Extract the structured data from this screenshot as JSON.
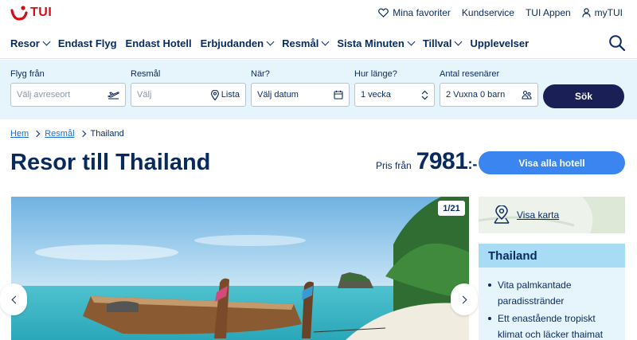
{
  "header": {
    "logo_text": "TUI",
    "links": [
      {
        "label": "Mina favoriter",
        "icon": "heart-icon"
      },
      {
        "label": "Kundservice"
      },
      {
        "label": "TUI Appen"
      },
      {
        "label": "myTUI",
        "icon": "user-icon"
      }
    ]
  },
  "nav": {
    "items": [
      {
        "label": "Resor",
        "dropdown": true
      },
      {
        "label": "Endast Flyg",
        "dropdown": false
      },
      {
        "label": "Endast Hotell",
        "dropdown": false
      },
      {
        "label": "Erbjudanden",
        "dropdown": true
      },
      {
        "label": "Resmål",
        "dropdown": true
      },
      {
        "label": "Sista Minuten",
        "dropdown": true
      },
      {
        "label": "Tillval",
        "dropdown": true
      },
      {
        "label": "Upplevelser",
        "dropdown": false
      }
    ]
  },
  "search": {
    "from": {
      "label": "Flyg från",
      "placeholder": "Välj avreseort"
    },
    "dest": {
      "label": "Resmål",
      "placeholder": "Välj",
      "list_label": "Lista"
    },
    "when": {
      "label": "När?",
      "value": "Välj datum"
    },
    "length": {
      "label": "Hur länge?",
      "value": "1 vecka"
    },
    "pax": {
      "label": "Antal resenärer",
      "value": "2 Vuxna 0 barn"
    },
    "submit_label": "Sök"
  },
  "breadcrumb": {
    "items": [
      "Hem",
      "Resmål"
    ],
    "current": "Thailand"
  },
  "page": {
    "title": "Resor till Thailand",
    "price_prefix": "Pris från",
    "price_value": "7981",
    "price_suffix": ":-",
    "hotels_button": "Visa alla hotell"
  },
  "gallery": {
    "counter": "1/21"
  },
  "sidebar": {
    "map_link": "Visa karta",
    "info_title": "Thailand",
    "bullets": [
      "Vita palmkantade paradisstränder",
      "Ett enastående tropiskt klimat och läcker thaimat"
    ]
  },
  "colors": {
    "brand_red": "#d40e14",
    "navy": "#092a5e",
    "button_dark": "#1a1f55",
    "button_blue": "#3a85f0",
    "panel_light_blue": "#e6f4fc",
    "info_header": "#a8dcf4"
  }
}
